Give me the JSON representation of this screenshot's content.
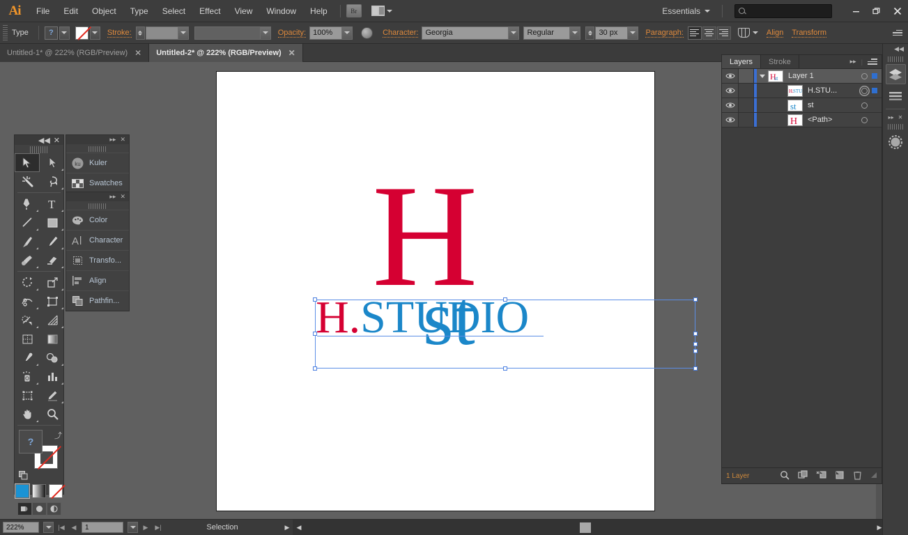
{
  "app": {
    "name": "Ai",
    "workspace": "Essentials",
    "search_placeholder": ""
  },
  "menubar": {
    "items": [
      "File",
      "Edit",
      "Object",
      "Type",
      "Select",
      "Effect",
      "View",
      "Window",
      "Help"
    ],
    "bridge_label": "Br"
  },
  "window_controls": {
    "minimize": "—",
    "restore": "❐",
    "close": "✕"
  },
  "controlbar": {
    "object_label": "Type",
    "fill_value": "?",
    "stroke_label": "Stroke:",
    "stroke_weight": "",
    "stroke_profile": "",
    "opacity_label": "Opacity:",
    "opacity_value": "100%",
    "character_label": "Character:",
    "font_family": "Georgia",
    "font_style": "Regular",
    "font_size": "30 px",
    "paragraph_label": "Paragraph:",
    "align_link": "Align",
    "transform_link": "Transform"
  },
  "tabs": [
    {
      "title": "Untitled-1* @ 222% (RGB/Preview)",
      "active": false,
      "close": "✕"
    },
    {
      "title": "Untitled-2* @ 222% (RGB/Preview)",
      "active": true,
      "close": "✕"
    }
  ],
  "artwork": {
    "letter_h": "H",
    "letters_st": "st",
    "wordmark_red": "H.",
    "wordmark_blue": "STUDIO",
    "color_red": "#D50032",
    "color_blue": "#1B87C9",
    "selection_color": "#5C8EE6"
  },
  "tools": {
    "panel_name": "Tools",
    "items": [
      "selection-tool",
      "direct-selection-tool",
      "magic-wand-tool",
      "lasso-tool",
      "pen-tool",
      "type-tool",
      "line-segment-tool",
      "rectangle-tool",
      "paintbrush-tool",
      "pencil-tool",
      "blob-brush-tool",
      "eraser-tool",
      "rotate-tool",
      "scale-tool",
      "width-tool",
      "free-transform-tool",
      "shape-builder-tool",
      "perspective-grid-tool",
      "mesh-tool",
      "gradient-tool",
      "eyedropper-tool",
      "blend-tool",
      "symbol-sprayer-tool",
      "column-graph-tool",
      "artboard-tool",
      "slice-tool",
      "hand-tool",
      "zoom-tool"
    ],
    "selected": "selection-tool",
    "fill_label": "?",
    "color_modes": [
      "color",
      "gradient",
      "none"
    ],
    "screen_mode": "normal-screen-mode"
  },
  "left_panels": [
    {
      "name": "kuler-swatches-group",
      "rows": [
        {
          "icon": "kuler-icon",
          "label": "Kuler"
        },
        {
          "icon": "swatches-icon",
          "label": "Swatches"
        }
      ]
    },
    {
      "name": "color-character-group",
      "rows": [
        {
          "icon": "color-icon",
          "label": "Color"
        },
        {
          "icon": "character-icon",
          "label": "Character"
        },
        {
          "icon": "transform-icon",
          "label": "Transfo..."
        },
        {
          "icon": "align-icon",
          "label": "Align"
        },
        {
          "icon": "pathfinder-icon",
          "label": "Pathfin..."
        }
      ]
    }
  ],
  "layers_panel": {
    "tabs": [
      {
        "label": "Layers",
        "active": true
      },
      {
        "label": "Stroke",
        "active": false
      }
    ],
    "rows": [
      {
        "name": "Layer 1",
        "indent": 0,
        "expanded": true,
        "visible": true,
        "selected": true,
        "thumb": "artwork-thumb",
        "target": "single",
        "has_selection_box": true
      },
      {
        "name": "H.STU...",
        "indent": 1,
        "expanded": false,
        "visible": true,
        "selected": false,
        "thumb": "text-thumb",
        "target": "double",
        "has_selection_box": true
      },
      {
        "name": "st",
        "indent": 1,
        "expanded": false,
        "visible": true,
        "selected": false,
        "thumb": "st-thumb",
        "target": "single",
        "has_selection_box": false
      },
      {
        "name": "<Path>",
        "indent": 1,
        "expanded": false,
        "visible": true,
        "selected": false,
        "thumb": "path-thumb",
        "target": "single",
        "has_selection_box": false
      }
    ],
    "footer": {
      "count": "1 Layer",
      "icons": [
        "locate-object-icon",
        "make-clipping-mask-icon",
        "create-new-sublayer-icon",
        "create-new-layer-icon",
        "delete-selection-icon"
      ]
    }
  },
  "right_dock": {
    "buttons": [
      "layers-panel-icon",
      "align-panel-icon",
      "symbols-panel-icon"
    ]
  },
  "statusbar": {
    "zoom": "222%",
    "page": "1",
    "status_text": "Selection"
  }
}
